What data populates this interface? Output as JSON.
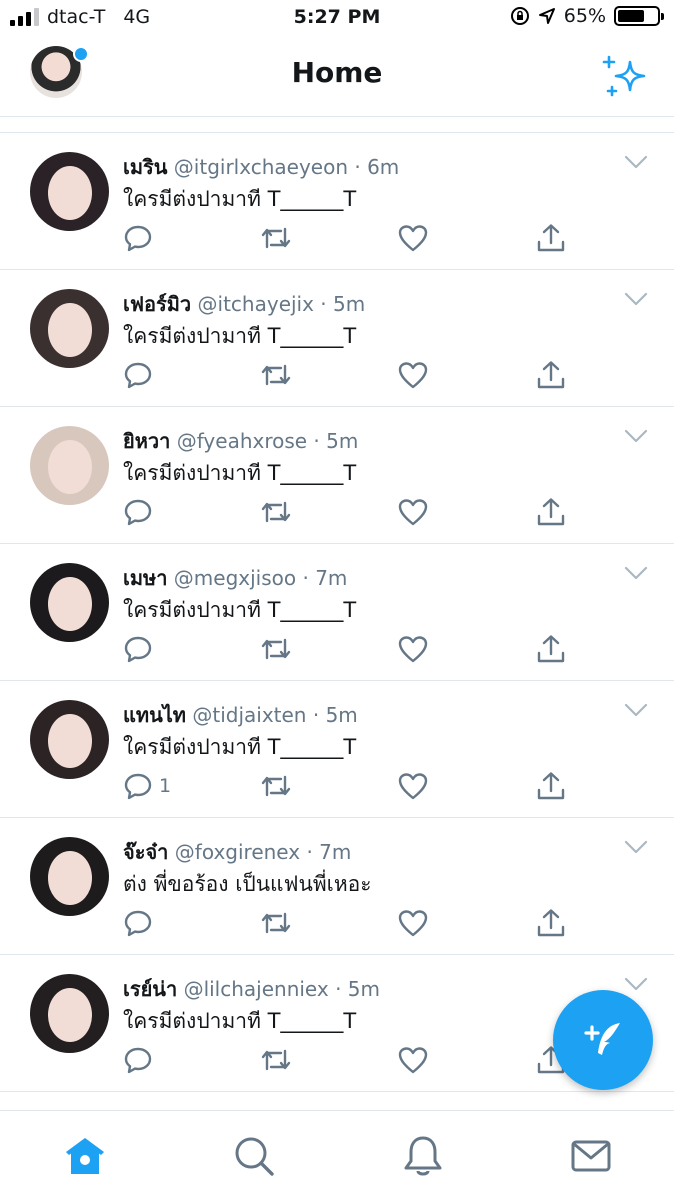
{
  "status_bar": {
    "carrier": "dtac-T",
    "network": "4G",
    "time": "5:27 PM",
    "battery": "65%"
  },
  "header": {
    "title": "Home"
  },
  "tweets": [
    {
      "name": "เมริน",
      "handle": "@itgirlxchaeyeon",
      "time": "6m",
      "text": "ใครมีต่งปามาที T______T",
      "reply_count": "",
      "avatar_color": "#2a2226"
    },
    {
      "name": "เฟอร์มิว",
      "handle": "@itchayejix",
      "time": "5m",
      "text": "ใครมีต่งปามาที T______T",
      "reply_count": "",
      "avatar_color": "#3a3030"
    },
    {
      "name": "ยิหวา",
      "handle": "@fyeahxrose",
      "time": "5m",
      "text": "ใครมีต่งปามาที T______T",
      "reply_count": "",
      "avatar_color": "#d7c7bd"
    },
    {
      "name": "เมษา",
      "handle": "@megxjisoo",
      "time": "7m",
      "text": "ใครมีต่งปามาที T______T",
      "reply_count": "",
      "avatar_color": "#1c1a1c"
    },
    {
      "name": "แทนไท",
      "handle": "@tidjaixten",
      "time": "5m",
      "text": "ใครมีต่งปามาที T______T",
      "reply_count": "1",
      "avatar_color": "#2b2324"
    },
    {
      "name": "จ๊ะจ๋า",
      "handle": "@foxgirenex",
      "time": "7m",
      "text": "ต่ง พี่ขอร้อง เป็นแฟนพี่เหอะ",
      "reply_count": "",
      "avatar_color": "#1e1b1d"
    },
    {
      "name": "เรย์น่า",
      "handle": "@lilchajenniex",
      "time": "5m",
      "text": "ใครมีต่งปามาที T______T",
      "reply_count": "",
      "avatar_color": "#231e20"
    }
  ],
  "colors": {
    "accent": "#1da1f2",
    "meta_text": "#657786",
    "divider": "#e1e8ed"
  },
  "icons": {
    "header": [
      "avatar",
      "sparkle-icon"
    ],
    "tweet_actions": [
      "reply-icon",
      "retweet-icon",
      "like-icon",
      "share-icon"
    ],
    "tabs": [
      "home-icon",
      "search-icon",
      "notifications-icon",
      "messages-icon"
    ],
    "fab": "compose-tweet-icon"
  }
}
